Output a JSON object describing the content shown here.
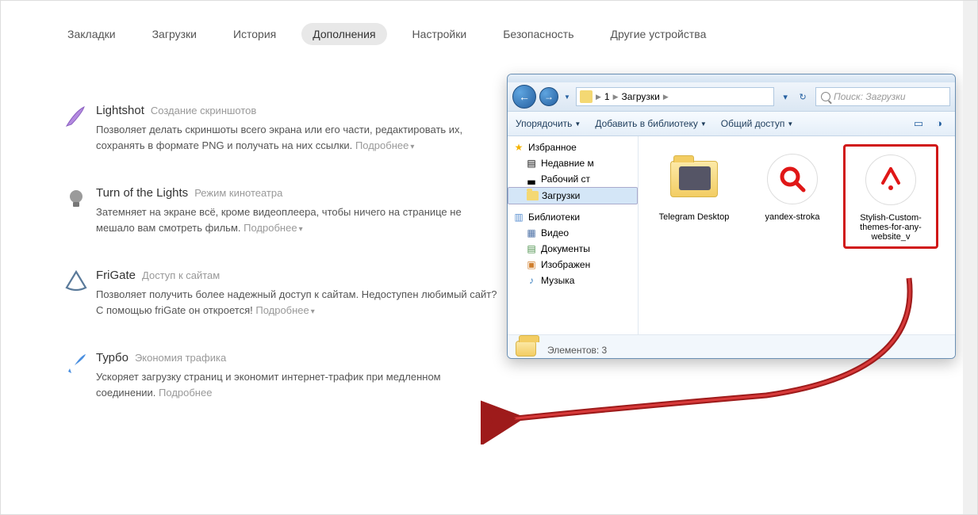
{
  "tabs": {
    "bookmarks": "Закладки",
    "downloads": "Загрузки",
    "history": "История",
    "addons": "Дополнения",
    "settings": "Настройки",
    "security": "Безопасность",
    "devices": "Другие устройства"
  },
  "more_label": "Подробнее",
  "extensions": [
    {
      "name": "Lightshot",
      "sub": "Создание скриншотов",
      "desc": "Позволяет делать скриншоты всего экрана или его части, редактировать их, сохранять в формате PNG и получать на них ссылки."
    },
    {
      "name": "Turn of the Lights",
      "sub": "Режим кинотеатра",
      "desc": "Затемняет на экране всё, кроме видеоплеера, чтобы ничего на странице не мешало вам смотреть фильм."
    },
    {
      "name": "FriGate",
      "sub": "Доступ к сайтам",
      "desc": "Позволяет получить более надежный доступ к сайтам. Недоступен любимый сайт? С помощью friGate он откроется!"
    },
    {
      "name": "Турбо",
      "sub": "Экономия трафика",
      "desc": "Ускоряет загрузку страниц и экономит интернет-трафик при медленном соединении."
    }
  ],
  "explorer": {
    "path": {
      "seg1": "1",
      "seg2": "Загрузки"
    },
    "search_placeholder": "Поиск: Загрузки",
    "toolbar": {
      "organize": "Упорядочить",
      "add_library": "Добавить в библиотеку",
      "share": "Общий доступ"
    },
    "tree": {
      "favorites": "Избранное",
      "recent": "Недавние м",
      "desktop": "Рабочий ст",
      "downloads": "Загрузки",
      "libraries": "Библиотеки",
      "video": "Видео",
      "documents": "Документы",
      "pictures": "Изображен",
      "music": "Музыка"
    },
    "files": {
      "telegram": "Telegram Desktop",
      "yandex": "yandex-stroka",
      "stylish": "Stylish-Custom-themes-for-any-website_v"
    },
    "status": "Элементов: 3"
  }
}
